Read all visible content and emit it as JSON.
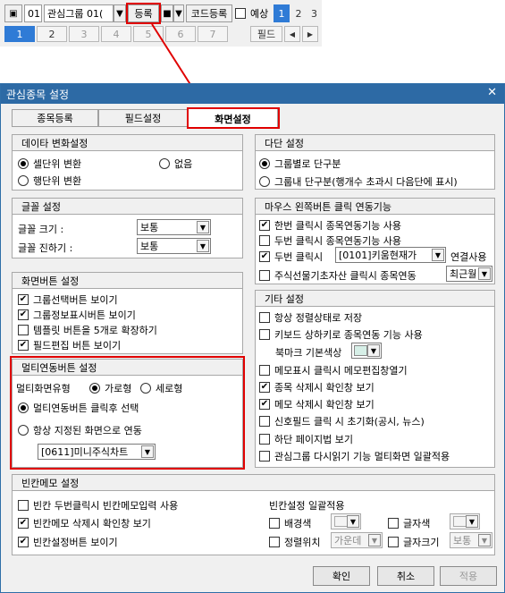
{
  "toolbar": {
    "group_no": "01",
    "group_name": "관심그룹 01(",
    "register_button": "등록",
    "code_register_button": "코드등록",
    "forecast_label": "예상",
    "right_pages": [
      "1",
      "2",
      "3"
    ],
    "pages": [
      "1",
      "2",
      "3",
      "4",
      "5",
      "6",
      "7"
    ],
    "field_button": "필드",
    "prev_icon": "◀",
    "next_icon": "▶"
  },
  "dialog": {
    "title": "관심종목 설정",
    "tabs": [
      "종목등록",
      "필드설정",
      "화면설정"
    ],
    "data_change": {
      "title": "데이타 변화설정",
      "cell": "셀단위 변환",
      "none": "없음",
      "row": "행단위 변환"
    },
    "font": {
      "title": "글꼴 설정",
      "size_label": "글꼴 크기 :",
      "size_value": "보통",
      "weight_label": "글꼴 진하기 :",
      "weight_value": "보통"
    },
    "screen_buttons": {
      "title": "화면버튼 설정",
      "items": [
        "그룹선택버튼 보이기",
        "그룹정보표시버튼 보이기",
        "템플릿 버튼을 5개로 확장하기",
        "필드편집 버튼 보이기"
      ]
    },
    "multi_link": {
      "title": "멀티연동버튼 설정",
      "type_label": "멀티화면유형",
      "horizontal": "가로형",
      "vertical": "세로형",
      "after_click": "멀티연동버튼 클릭후 선택",
      "always": "항상 지정된 화면으로 연동",
      "screen_value": "[0611]미니주식차트"
    },
    "multi_column": {
      "title": "다단 설정",
      "by_group": "그룹별로 단구분",
      "in_group": "그룹내 단구분(행개수 초과시 다음단에 표시)"
    },
    "mouse_left": {
      "title": "마우스 왼쪽버튼 클릭 연동기능",
      "single": "한번 클릭시 종목연동기능 사용",
      "double": "두번 클릭시 종목연동기능 사용",
      "double2_prefix": "두번 클릭시",
      "double2_value": "[0101]키움현재가",
      "double2_suffix": "연결사용",
      "futures_text": "주식선물기초자산 클릭시 종목연동",
      "futures_value": "최근월"
    },
    "etc": {
      "title": "기타 설정",
      "always_sort": "항상 정렬상태로 저장",
      "keyboard": "키보드 상하키로 종목연동 기능 사용",
      "bookmark_color": "북마크 기본색상",
      "memo_click": "메모표시 클릭시 메모편집창열기",
      "delete_confirm": "종목 삭제시 확인창 보기",
      "memo_delete_confirm": "메모 삭제시 확인창 보기",
      "signal_reset": "신호필드 클릭 시 초기화(공시, 뉴스)",
      "bottom_paging": "하단 페이지법 보기",
      "reread_all": "관심그룹 다시읽기 기능 멀티화면 일괄적용"
    },
    "blank_memo": {
      "title": "빈칸메모 설정",
      "double_click": "빈칸 두번클릭시 빈칸메모입력 사용",
      "delete_confirm": "빈칸메모 삭제시 확인창 보기",
      "show_button": "빈칸설정버튼 보이기",
      "bulk_title": "빈칸설정 일괄적용",
      "bg_color": "배경색",
      "text_color": "글자색",
      "align": "정렬위치",
      "align_value": "가운데",
      "text_size": "글자크기",
      "text_size_value": "보통"
    },
    "buttons": {
      "ok": "확인",
      "cancel": "취소",
      "apply": "적용"
    }
  },
  "colors": {
    "accent": "#2f7bd6",
    "title_bar": "#2d6aa5",
    "highlight_box": "#e00000"
  }
}
